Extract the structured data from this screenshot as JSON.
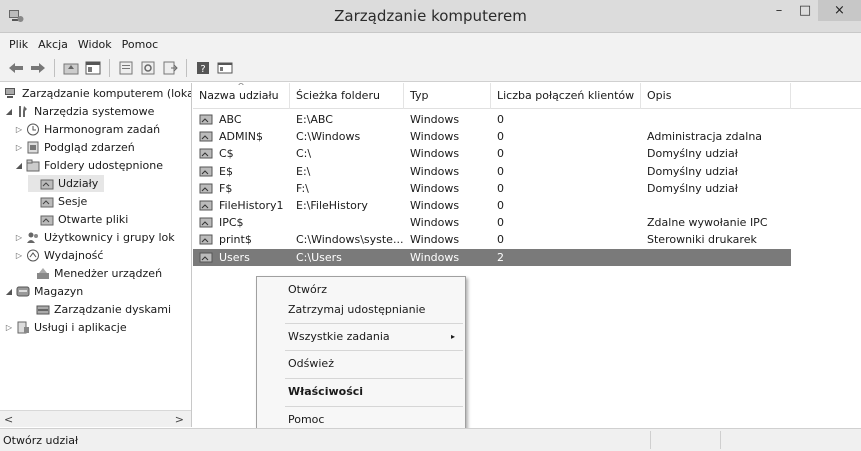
{
  "window": {
    "title": "Zarządzanie komputerem",
    "controls": {
      "minimize": "–",
      "maximize": "□",
      "close": "×"
    }
  },
  "menubar": [
    "Plik",
    "Akcja",
    "Widok",
    "Pomoc"
  ],
  "toolbar": {
    "icons": [
      "back-arrow-icon",
      "forward-arrow-icon",
      "up-folder-icon",
      "show-hide-tree-icon",
      "properties-icon",
      "refresh-icon",
      "export-list-icon",
      "help-icon",
      "console-window-icon"
    ]
  },
  "tree": {
    "items": [
      {
        "label": "Zarządzanie komputerem (loka",
        "icon": "computer-management-icon",
        "arrow": ""
      },
      {
        "label": "Narzędzia systemowe",
        "icon": "tools-icon",
        "arrow": "◢"
      },
      {
        "label": "Harmonogram zadań",
        "icon": "clock-icon",
        "arrow": "▷"
      },
      {
        "label": "Podgląd zdarzeń",
        "icon": "event-viewer-icon",
        "arrow": "▷"
      },
      {
        "label": "Foldery udostępnione",
        "icon": "shared-folder-icon",
        "arrow": "◢"
      },
      {
        "label": "Udziały",
        "icon": "share-icon",
        "arrow": ""
      },
      {
        "label": "Sesje",
        "icon": "share-icon",
        "arrow": ""
      },
      {
        "label": "Otwarte pliki",
        "icon": "share-icon",
        "arrow": ""
      },
      {
        "label": "Użytkownicy i grupy lok",
        "icon": "users-icon",
        "arrow": "▷"
      },
      {
        "label": "Wydajność",
        "icon": "performance-icon",
        "arrow": "▷"
      },
      {
        "label": "Menedżer urządzeń",
        "icon": "device-manager-icon",
        "arrow": ""
      },
      {
        "label": "Magazyn",
        "icon": "storage-icon",
        "arrow": "◢"
      },
      {
        "label": "Zarządzanie dyskami",
        "icon": "disk-icon",
        "arrow": ""
      },
      {
        "label": "Usługi i aplikacje",
        "icon": "services-icon",
        "arrow": "▷"
      }
    ],
    "scroll_left": "<",
    "scroll_right": ">"
  },
  "list": {
    "columns": [
      "Nazwa udziału",
      "Ścieżka folderu",
      "Typ",
      "Liczba połączeń klientów",
      "Opis"
    ],
    "sort_indicator": "^",
    "rows": [
      [
        "ABC",
        "E:\\ABC",
        "Windows",
        "0",
        ""
      ],
      [
        "ADMIN$",
        "C:\\Windows",
        "Windows",
        "0",
        "Administracja zdalna"
      ],
      [
        "C$",
        "C:\\",
        "Windows",
        "0",
        "Domyślny udział"
      ],
      [
        "E$",
        "E:\\",
        "Windows",
        "0",
        "Domyślny udział"
      ],
      [
        "F$",
        "F:\\",
        "Windows",
        "0",
        "Domyślny udział"
      ],
      [
        "FileHistory1",
        "E:\\FileHistory",
        "Windows",
        "0",
        ""
      ],
      [
        "IPC$",
        "",
        "Windows",
        "0",
        "Zdalne wywołanie IPC"
      ],
      [
        "print$",
        "C:\\Windows\\syste...",
        "Windows",
        "0",
        "Sterowniki drukarek"
      ],
      [
        "Users",
        "C:\\Users",
        "Windows",
        "2",
        ""
      ]
    ],
    "selected_row": "Users"
  },
  "context_menu": {
    "items": [
      {
        "label": "Otwórz"
      },
      {
        "label": "Zatrzymaj udostępnianie"
      },
      {
        "label": "Wszystkie zadania",
        "submenu_arrow": "▸"
      },
      {
        "label": "Odśwież"
      },
      {
        "label": "Właściwości"
      },
      {
        "label": "Pomoc"
      }
    ]
  },
  "statusbar": {
    "text": "Otwórz udział"
  },
  "colors": {
    "selection": "#7a7a7a",
    "titlebar": "#dcdcdc",
    "menu_bg": "#f7f7f7"
  }
}
